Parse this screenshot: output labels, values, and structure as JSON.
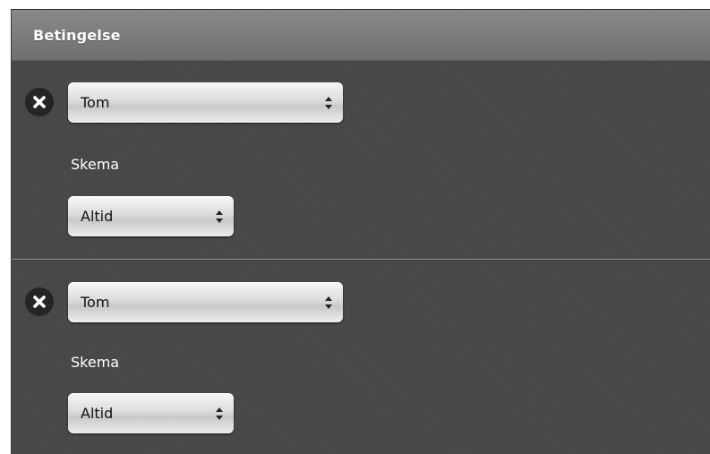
{
  "header": {
    "title": "Betingelse"
  },
  "conditions": [
    {
      "type_value": "Tom",
      "schedule_label": "Skema",
      "schedule_value": "Altid"
    },
    {
      "type_value": "Tom",
      "schedule_label": "Skema",
      "schedule_value": "Altid"
    }
  ],
  "icons": {
    "remove": "close-icon",
    "select_arrows": "updown-arrows-icon"
  },
  "colors": {
    "panel_bg": "#474747",
    "header_bg": "#7d7d7d",
    "remove_button_bg": "#252525"
  }
}
